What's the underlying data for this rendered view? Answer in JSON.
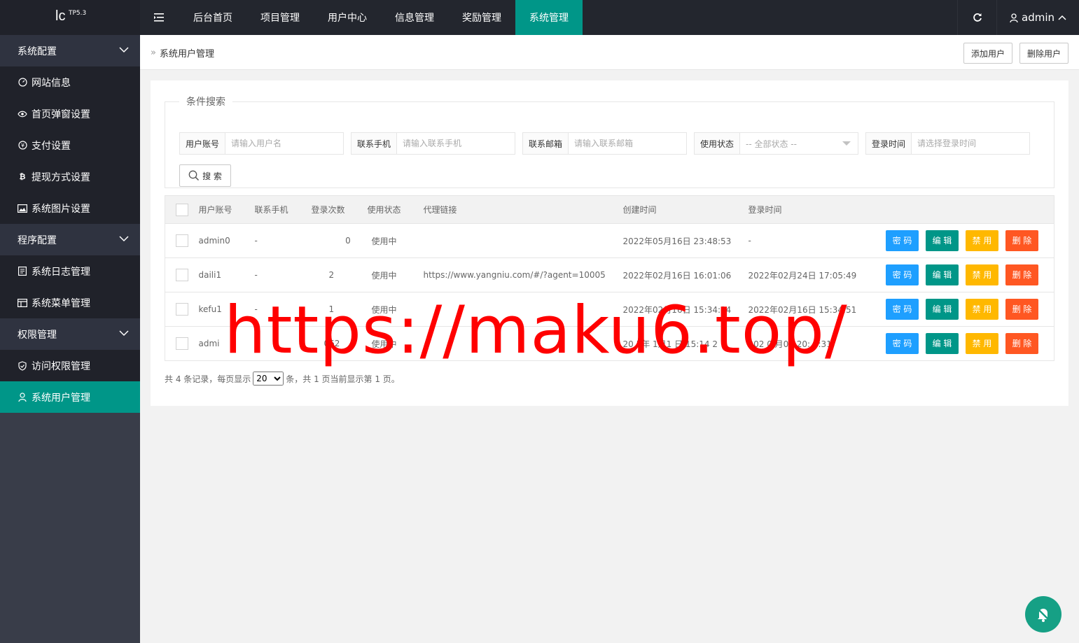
{
  "app": {
    "logo": "lc",
    "version": "TP5.3"
  },
  "topnav": {
    "items": [
      {
        "label": "后台首页"
      },
      {
        "label": "项目管理"
      },
      {
        "label": "用户中心"
      },
      {
        "label": "信息管理"
      },
      {
        "label": "奖励管理"
      },
      {
        "label": "系统管理",
        "active": true
      }
    ],
    "user": "admin"
  },
  "sidebar": {
    "group1": "系统配置",
    "item1": "网站信息",
    "item2": "首页弹窗设置",
    "item3": "支付设置",
    "item4": "提现方式设置",
    "item5": "系统图片设置",
    "group2": "程序配置",
    "item6": "系统日志管理",
    "item7": "系统菜单管理",
    "group3": "权限管理",
    "item8": "访问权限管理",
    "item9": "系统用户管理"
  },
  "breadcrumb": {
    "current": "系统用户管理"
  },
  "actions": {
    "add": "添加用户",
    "delete": "删除用户"
  },
  "search": {
    "legend": "条件搜索",
    "username_label": "用户账号",
    "username_placeholder": "请输入用户名",
    "phone_label": "联系手机",
    "phone_placeholder": "请输入联系手机",
    "email_label": "联系邮箱",
    "email_placeholder": "请输入联系邮箱",
    "status_label": "使用状态",
    "status_value": "-- 全部状态 --",
    "login_label": "登录时间",
    "login_placeholder": "请选择登录时间",
    "button": "搜 索"
  },
  "table": {
    "headers": {
      "username": "用户账号",
      "phone": "联系手机",
      "logins": "登录次数",
      "status": "使用状态",
      "link": "代理链接",
      "created": "创建时间",
      "login": "登录时间"
    },
    "rows": [
      {
        "username": "admin0",
        "phone": "-",
        "logins": "0",
        "status": "使用中",
        "link": "",
        "created": "2022年05月16日 23:48:53",
        "login": "-"
      },
      {
        "username": "daili1",
        "phone": "-",
        "logins": "2",
        "status": "使用中",
        "link": "https://www.yangniu.com/#/?agent=10005",
        "created": "2022年02月16日 16:01:06",
        "login": "2022年02月24日 17:05:49"
      },
      {
        "username": "kefu1",
        "phone": "-",
        "logins": "1",
        "status": "使用中",
        "link": "",
        "created": "2022年02月16日 15:34:34",
        "login": "2022年02月16日 15:34:51"
      },
      {
        "username": "admi",
        "phone": "-",
        "logins": "062",
        "status": "使用中",
        "link": "",
        "created": "20 5年 1月1 日 15:14 2",
        "login": "202 0 月08 20: 8:31"
      }
    ],
    "ops": {
      "pwd": "密 码",
      "edit": "编 辑",
      "ban": "禁 用",
      "del": "删 除"
    }
  },
  "pager": {
    "prefix": "共 4 条记录，每页显示",
    "per_page": "20",
    "suffix": "条，共 1 页当前显示第 1 页。"
  },
  "watermark": "https://maku6.top/",
  "colors": {
    "primary": "#009688",
    "sidebar": "#393d49",
    "topbar": "#23262e",
    "pwd": "#1e9fff",
    "ban": "#ffb800",
    "del": "#ff5722"
  }
}
